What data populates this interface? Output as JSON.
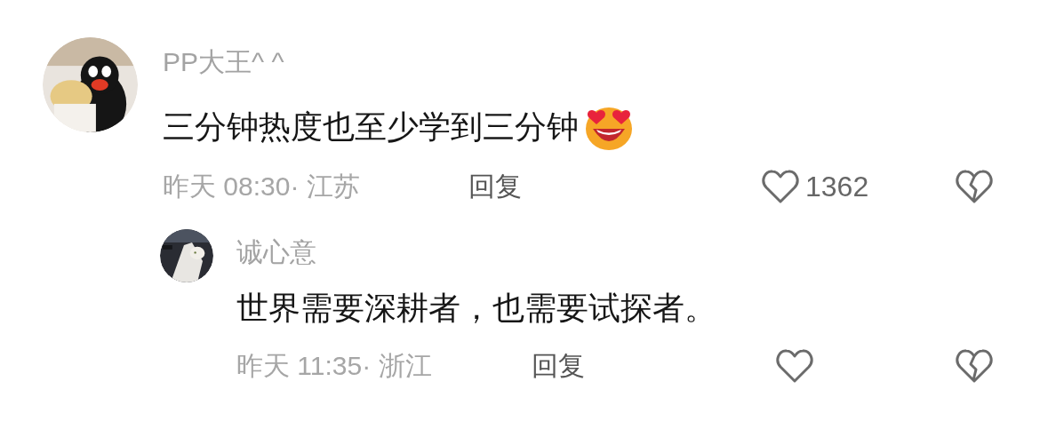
{
  "comments": [
    {
      "author": "PP大王^ ^",
      "text": "三分钟热度也至少学到三分钟",
      "has_emoji": true,
      "meta": "昨天 08:30· 江苏",
      "reply_label": "回复",
      "likes": "1362",
      "replies": [
        {
          "author": "诚心意",
          "text": "世界需要深耕者，也需要试探者。",
          "has_emoji": false,
          "meta": "昨天 11:35· 浙江",
          "reply_label": "回复"
        }
      ]
    }
  ]
}
